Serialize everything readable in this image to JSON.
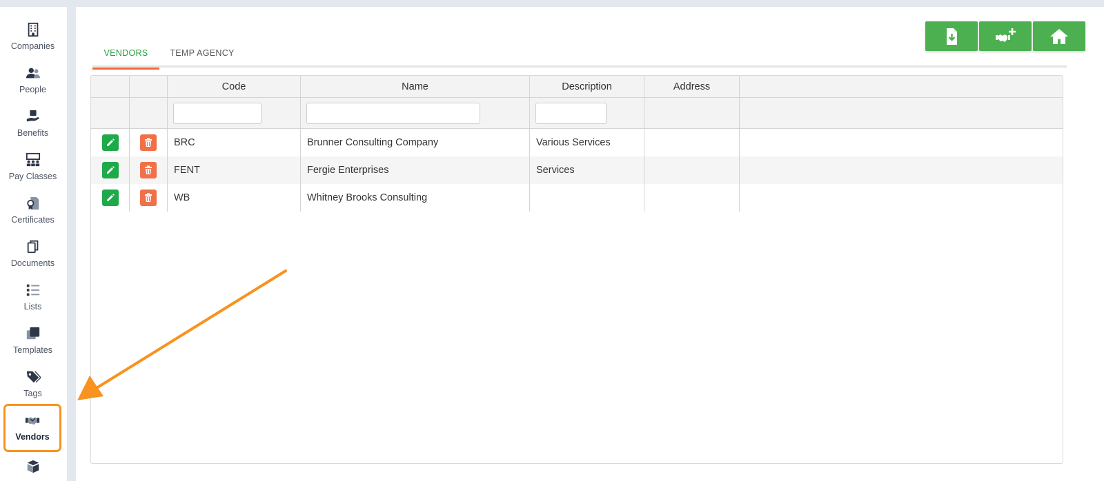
{
  "sidebar": {
    "items": [
      {
        "label": "Companies",
        "icon": "building-icon"
      },
      {
        "label": "People",
        "icon": "people-icon"
      },
      {
        "label": "Benefits",
        "icon": "benefits-hand-icon"
      },
      {
        "label": "Pay Classes",
        "icon": "pay-classes-icon"
      },
      {
        "label": "Certificates",
        "icon": "certificate-icon"
      },
      {
        "label": "Documents",
        "icon": "documents-icon"
      },
      {
        "label": "Lists",
        "icon": "list-icon"
      },
      {
        "label": "Templates",
        "icon": "templates-icon"
      },
      {
        "label": "Tags",
        "icon": "tags-icon"
      },
      {
        "label": "Vendors",
        "icon": "handshake-icon",
        "active": true
      }
    ]
  },
  "tabs": [
    {
      "label": "VENDORS",
      "active": true
    },
    {
      "label": "TEMP AGENCY",
      "active": false
    }
  ],
  "toolbar": {
    "buttons": [
      "file-download-icon",
      "handshake-add-icon",
      "home-icon"
    ]
  },
  "table": {
    "columns": [
      "",
      "",
      "Code",
      "Name",
      "Description",
      "Address",
      ""
    ],
    "filters": {
      "code": "",
      "name": "",
      "description": ""
    },
    "rows": [
      {
        "code": "BRC",
        "name": "Brunner Consulting Company",
        "description": "Various Services",
        "address": ""
      },
      {
        "code": "FENT",
        "name": "Fergie Enterprises",
        "description": "Services",
        "address": ""
      },
      {
        "code": "WB",
        "name": "Whitney Brooks Consulting",
        "description": "",
        "address": ""
      }
    ]
  },
  "colors": {
    "accent_green": "#4cb050",
    "edit_green": "#1faa4a",
    "delete_orange": "#f07149",
    "tab_underline": "#f26b3a",
    "annotation_orange": "#f7931e"
  }
}
